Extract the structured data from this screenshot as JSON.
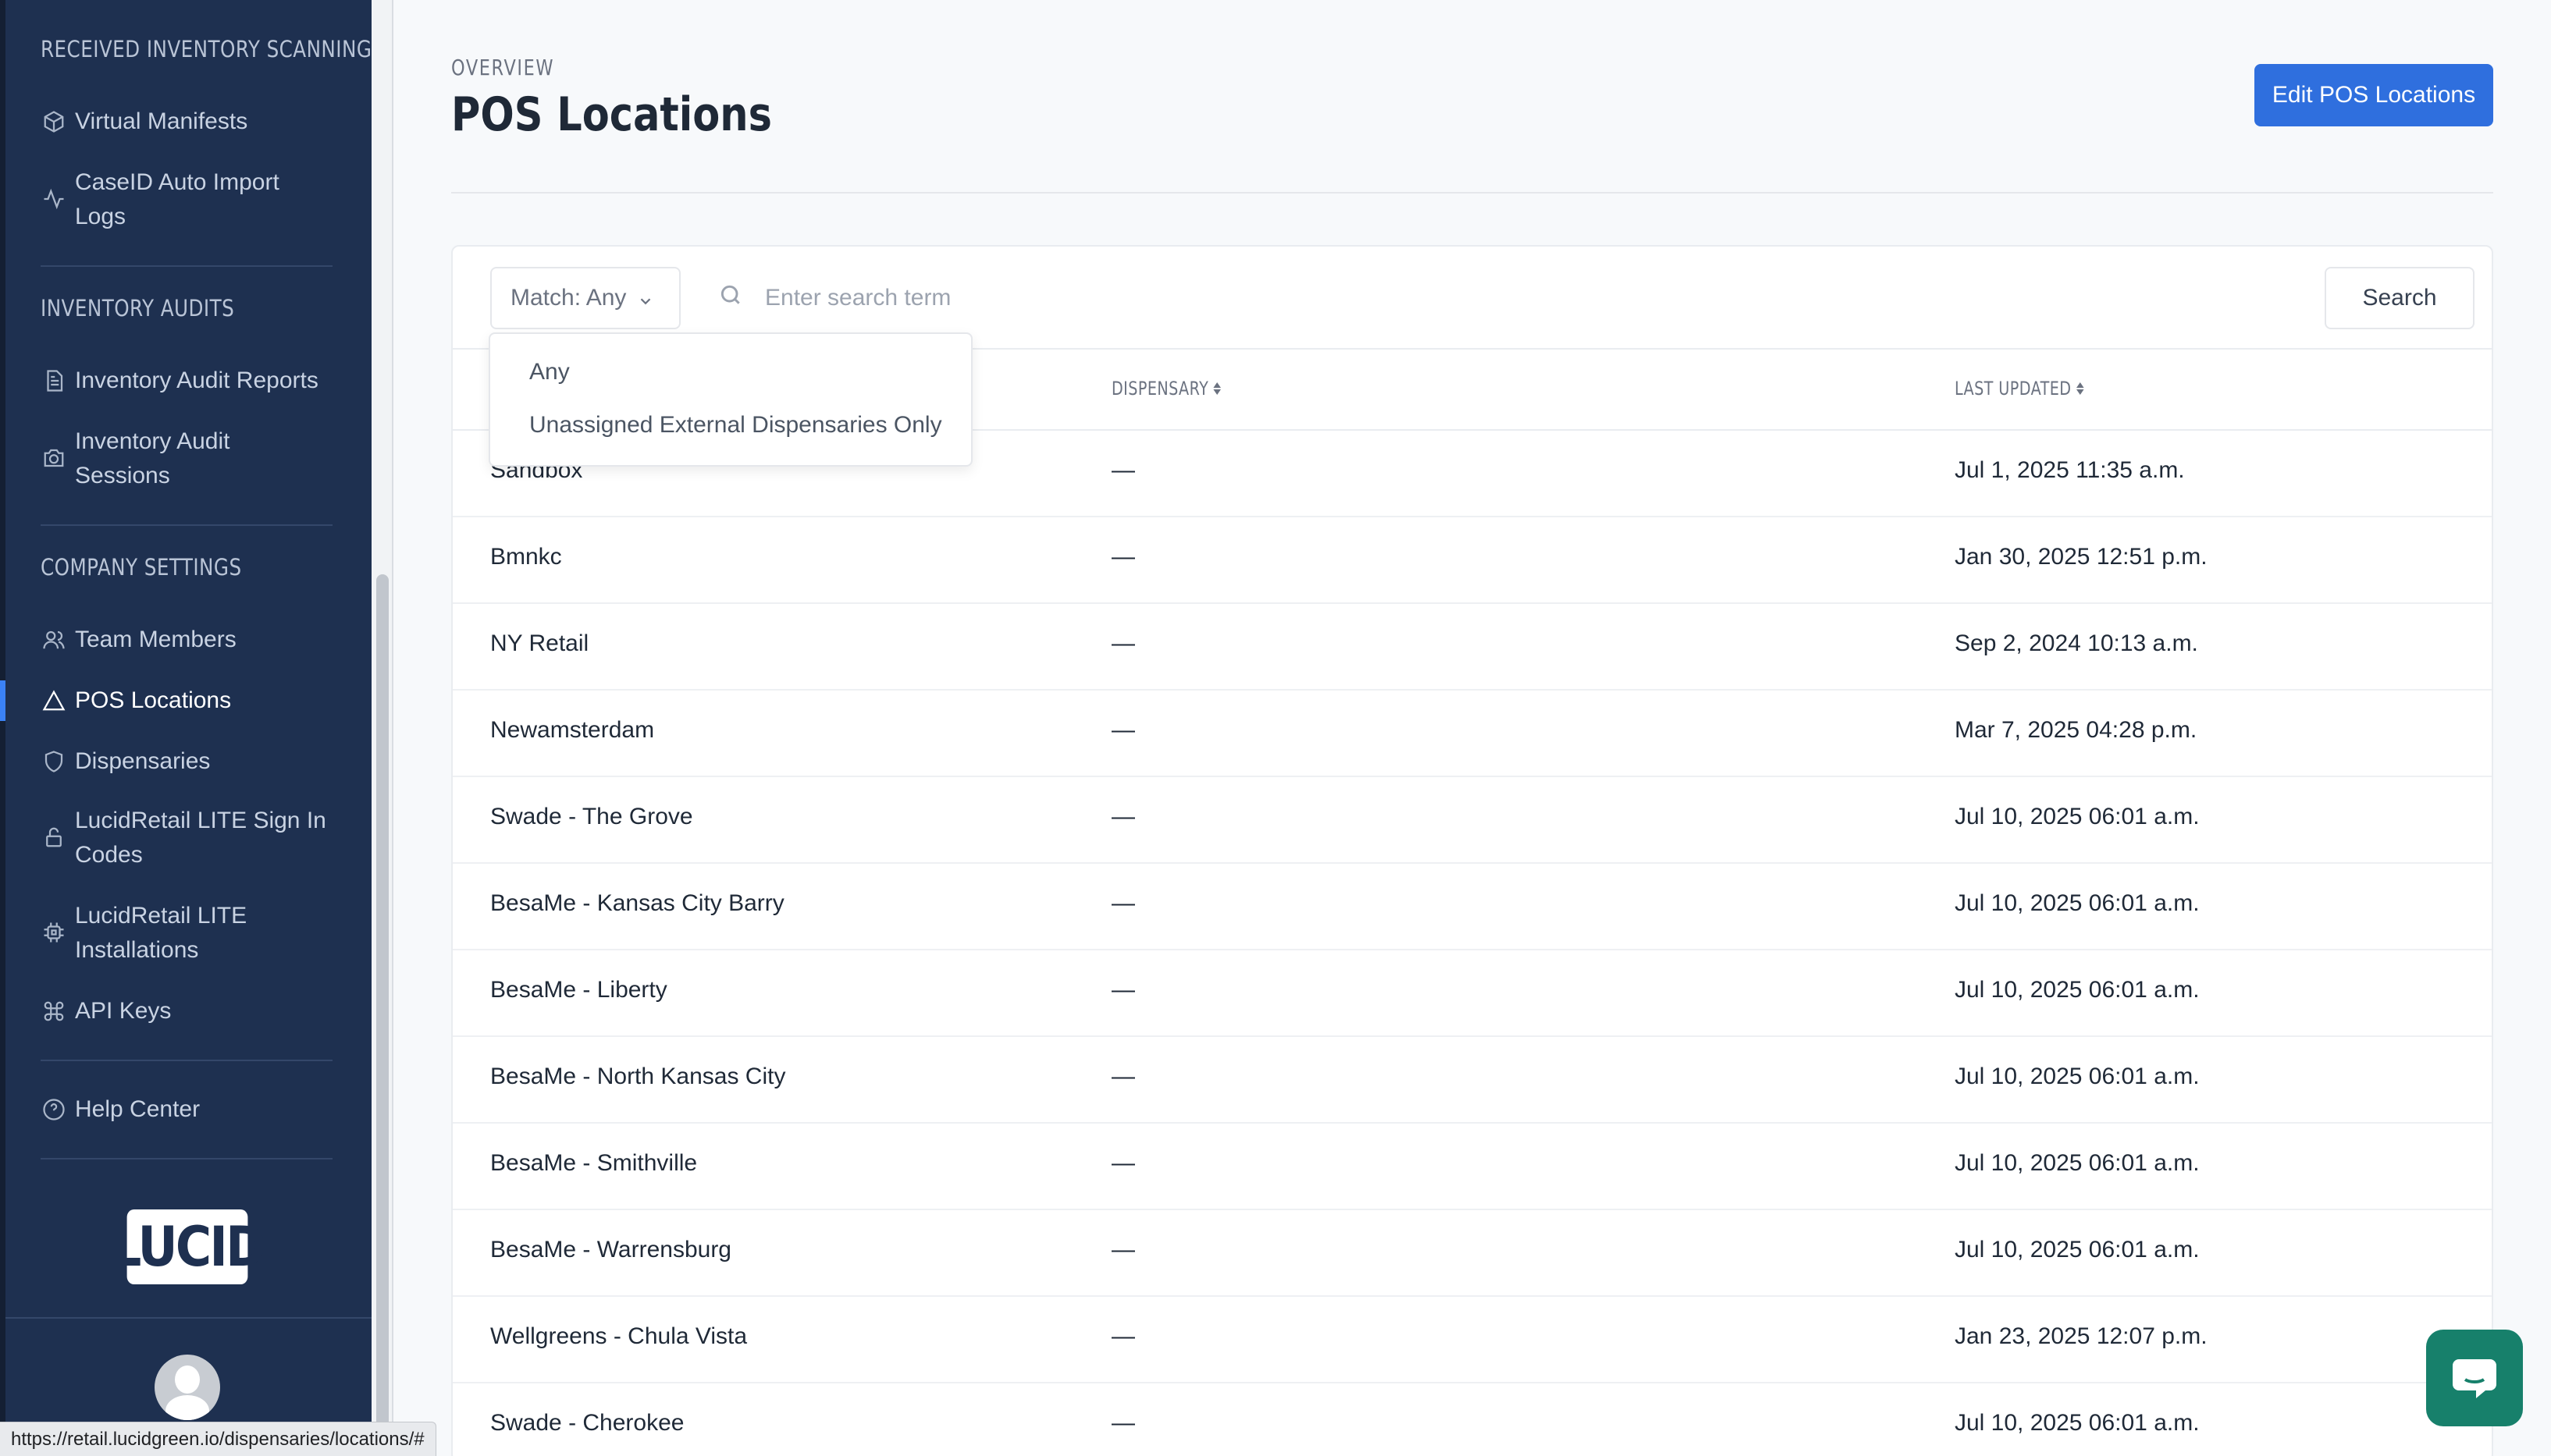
{
  "sidebar": {
    "sections": [
      {
        "title": "RECEIVED INVENTORY SCANNING"
      },
      {
        "title": "INVENTORY AUDITS"
      },
      {
        "title": "COMPANY SETTINGS"
      }
    ],
    "items": [
      {
        "label": "Virtual Manifests",
        "icon": "box-icon"
      },
      {
        "label": "CaseID Auto Import",
        "label2": "Logs",
        "icon": "activity-icon"
      },
      {
        "label": "Inventory Audit Reports",
        "icon": "document-icon"
      },
      {
        "label": "Inventory Audit",
        "label2": "Sessions",
        "icon": "camera-icon"
      },
      {
        "label": "Team Members",
        "icon": "users-icon"
      },
      {
        "label": "POS Locations",
        "icon": "triangle-icon",
        "active": true
      },
      {
        "label": "Dispensaries",
        "icon": "shield-icon"
      },
      {
        "label": "LucidRetail LITE Sign In",
        "label2": "Codes",
        "icon": "lock-icon"
      },
      {
        "label": "LucidRetail LITE",
        "label2": "Installations",
        "icon": "chip-icon"
      },
      {
        "label": "API Keys",
        "icon": "command-icon"
      },
      {
        "label": "Help Center",
        "icon": "help-circle-icon"
      }
    ],
    "logo_text": "LUCID"
  },
  "header": {
    "overline": "OVERVIEW",
    "title": "POS Locations",
    "edit_button": "Edit POS Locations"
  },
  "toolbar": {
    "match_label": "Match: Any",
    "search_placeholder": "Enter search term",
    "search_button": "Search"
  },
  "match_dropdown": {
    "options": [
      "Any",
      "Unassigned External Dispensaries Only"
    ]
  },
  "table": {
    "columns": [
      "DISPENSARY",
      "LAST UPDATED"
    ],
    "rows": [
      {
        "name": "Sandbox",
        "dispensary": "—",
        "updated": "Jul 1, 2025 11:35 a.m."
      },
      {
        "name": "Bmnkc",
        "dispensary": "—",
        "updated": "Jan 30, 2025 12:51 p.m."
      },
      {
        "name": "NY Retail",
        "dispensary": "—",
        "updated": "Sep 2, 2024 10:13 a.m."
      },
      {
        "name": "Newamsterdam",
        "dispensary": "—",
        "updated": "Mar 7, 2025 04:28 p.m."
      },
      {
        "name": "Swade - The Grove",
        "dispensary": "—",
        "updated": "Jul 10, 2025 06:01 a.m."
      },
      {
        "name": "BesaMe - Kansas City Barry",
        "dispensary": "—",
        "updated": "Jul 10, 2025 06:01 a.m."
      },
      {
        "name": "BesaMe - Liberty",
        "dispensary": "—",
        "updated": "Jul 10, 2025 06:01 a.m."
      },
      {
        "name": "BesaMe - North Kansas City",
        "dispensary": "—",
        "updated": "Jul 10, 2025 06:01 a.m."
      },
      {
        "name": "BesaMe - Smithville",
        "dispensary": "—",
        "updated": "Jul 10, 2025 06:01 a.m."
      },
      {
        "name": "BesaMe - Warrensburg",
        "dispensary": "—",
        "updated": "Jul 10, 2025 06:01 a.m."
      },
      {
        "name": "Wellgreens - Chula Vista",
        "dispensary": "—",
        "updated": "Jan 23, 2025 12:07 p.m."
      },
      {
        "name": "Swade - Cherokee",
        "dispensary": "—",
        "updated": "Jul 10, 2025 06:01 a.m."
      }
    ]
  },
  "status_bar": {
    "url": "https://retail.lucidgreen.io/dispensaries/locations/#"
  },
  "colors": {
    "sidebar_bg": "#1e3050",
    "primary": "#2f6fde",
    "chat": "#17806b"
  }
}
